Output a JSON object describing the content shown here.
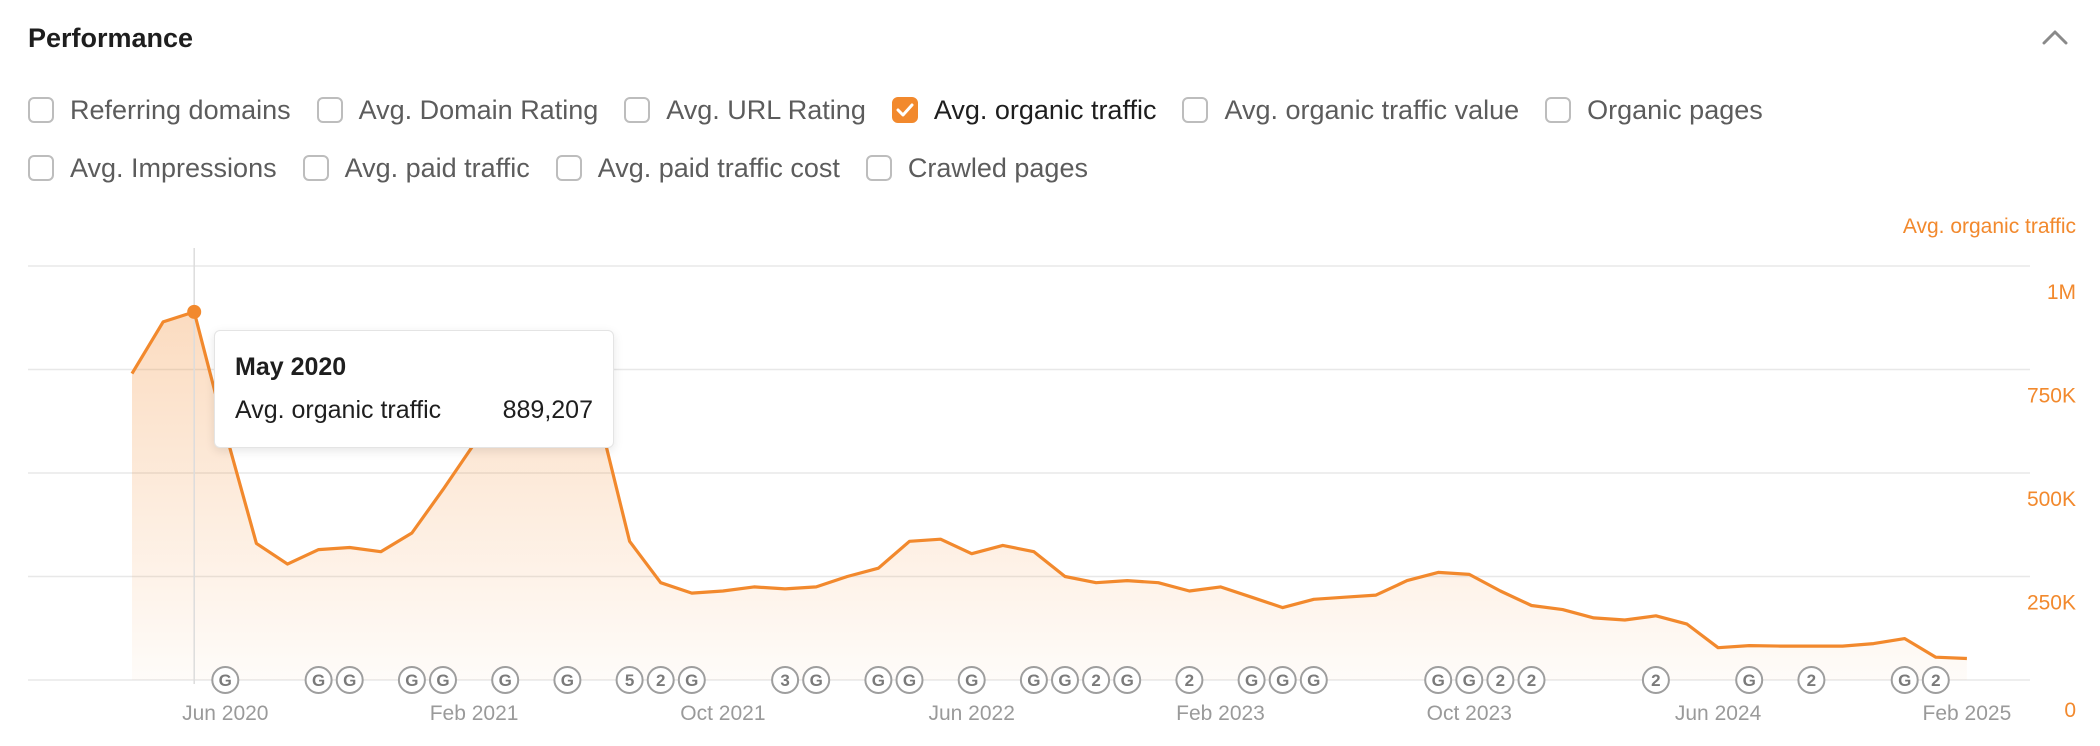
{
  "panel": {
    "title": "Performance"
  },
  "filters": [
    [
      {
        "label": "Referring domains",
        "checked": false
      },
      {
        "label": "Avg. Domain Rating",
        "checked": false
      },
      {
        "label": "Avg. URL Rating",
        "checked": false
      },
      {
        "label": "Avg. organic traffic",
        "checked": true
      },
      {
        "label": "Avg. organic traffic value",
        "checked": false
      },
      {
        "label": "Organic pages",
        "checked": false
      }
    ],
    [
      {
        "label": "Avg. Impressions",
        "checked": false
      },
      {
        "label": "Avg. paid traffic",
        "checked": false
      },
      {
        "label": "Avg. paid traffic cost",
        "checked": false
      },
      {
        "label": "Crawled pages",
        "checked": false
      }
    ]
  ],
  "colors": {
    "accent": "#f2892d",
    "grid": "#e8e8e8",
    "axis_text": "#9a9a9a",
    "marker": "#9e9e9e"
  },
  "tooltip": {
    "title": "May 2020",
    "metric": "Avg. organic traffic",
    "value": "889,207"
  },
  "chart_data": {
    "type": "area",
    "series": [
      {
        "name": "Avg. organic traffic",
        "x": [
          "2020-03",
          "2020-04",
          "2020-05",
          "2020-06",
          "2020-07",
          "2020-08",
          "2020-09",
          "2020-10",
          "2020-11",
          "2020-12",
          "2021-01",
          "2021-02",
          "2021-03",
          "2021-04",
          "2021-05",
          "2021-06",
          "2021-07",
          "2021-08",
          "2021-09",
          "2021-10",
          "2021-11",
          "2021-12",
          "2022-01",
          "2022-02",
          "2022-03",
          "2022-04",
          "2022-05",
          "2022-06",
          "2022-07",
          "2022-08",
          "2022-09",
          "2022-10",
          "2022-11",
          "2022-12",
          "2023-01",
          "2023-02",
          "2023-03",
          "2023-04",
          "2023-05",
          "2023-06",
          "2023-07",
          "2023-08",
          "2023-09",
          "2023-10",
          "2023-11",
          "2023-12",
          "2024-01",
          "2024-02",
          "2024-03",
          "2024-04",
          "2024-05",
          "2024-06",
          "2024-07",
          "2024-08",
          "2024-09",
          "2024-10",
          "2024-11",
          "2024-12",
          "2025-01",
          "2025-02"
        ],
        "values": [
          740000,
          865000,
          889207,
          600000,
          330000,
          280000,
          315000,
          320000,
          310000,
          355000,
          460000,
          570000,
          690000,
          730000,
          720000,
          640000,
          335000,
          235000,
          210000,
          215000,
          225000,
          220000,
          225000,
          250000,
          270000,
          335000,
          340000,
          305000,
          325000,
          310000,
          250000,
          235000,
          240000,
          235000,
          215000,
          225000,
          200000,
          175000,
          195000,
          200000,
          205000,
          240000,
          260000,
          255000,
          215000,
          180000,
          170000,
          150000,
          145000,
          155000,
          135000,
          78000,
          83000,
          82000,
          82000,
          82000,
          88000,
          100000,
          55000,
          52000
        ]
      }
    ],
    "x_tick_labels": [
      "Jun 2020",
      "Feb 2021",
      "Oct 2021",
      "Jun 2022",
      "Feb 2023",
      "Oct 2023",
      "Jun 2024",
      "Feb 2025"
    ],
    "x_tick_months": [
      "2020-06",
      "2021-02",
      "2021-10",
      "2022-06",
      "2023-02",
      "2023-10",
      "2024-06",
      "2025-02"
    ],
    "y_axis": {
      "label": "Avg. organic traffic",
      "ylim": [
        0,
        1000000
      ],
      "ticks": [
        0,
        250000,
        500000,
        750000,
        1000000
      ],
      "tick_labels": [
        "0",
        "250K",
        "500K",
        "750K",
        "1M"
      ],
      "position": "right"
    },
    "grid": true,
    "hover": {
      "x": "2020-05",
      "y": 889207
    },
    "markers": [
      {
        "x": "2020-06",
        "label": "G"
      },
      {
        "x": "2020-09",
        "label": "G"
      },
      {
        "x": "2020-10",
        "label": "G"
      },
      {
        "x": "2020-12",
        "label": "G"
      },
      {
        "x": "2021-01",
        "label": "G"
      },
      {
        "x": "2021-03",
        "label": "G"
      },
      {
        "x": "2021-05",
        "label": "G"
      },
      {
        "x": "2021-07",
        "label": "5"
      },
      {
        "x": "2021-08",
        "label": "2"
      },
      {
        "x": "2021-09",
        "label": "G"
      },
      {
        "x": "2021-12",
        "label": "3"
      },
      {
        "x": "2022-01",
        "label": "G"
      },
      {
        "x": "2022-03",
        "label": "G"
      },
      {
        "x": "2022-04",
        "label": "G"
      },
      {
        "x": "2022-06",
        "label": "G"
      },
      {
        "x": "2022-08",
        "label": "G"
      },
      {
        "x": "2022-09",
        "label": "G"
      },
      {
        "x": "2022-10",
        "label": "2"
      },
      {
        "x": "2022-11",
        "label": "G"
      },
      {
        "x": "2023-01",
        "label": "2"
      },
      {
        "x": "2023-03",
        "label": "G"
      },
      {
        "x": "2023-04",
        "label": "G"
      },
      {
        "x": "2023-05",
        "label": "G"
      },
      {
        "x": "2023-09",
        "label": "G"
      },
      {
        "x": "2023-10",
        "label": "G"
      },
      {
        "x": "2023-11",
        "label": "2"
      },
      {
        "x": "2023-12",
        "label": "2"
      },
      {
        "x": "2024-04",
        "label": "2"
      },
      {
        "x": "2024-07",
        "label": "G"
      },
      {
        "x": "2024-09",
        "label": "2"
      },
      {
        "x": "2024-12",
        "label": "G"
      },
      {
        "x": "2025-01",
        "label": "2"
      }
    ]
  }
}
